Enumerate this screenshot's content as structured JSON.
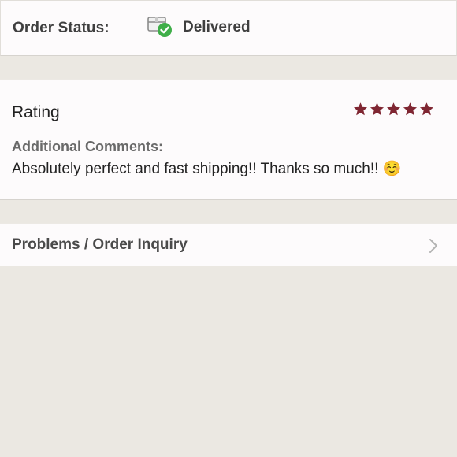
{
  "order_status": {
    "label": "Order Status:",
    "value": "Delivered",
    "icon": "package-delivered-icon",
    "status_color": "#3fae49"
  },
  "rating": {
    "title": "Rating",
    "stars": 5,
    "max_stars": 5,
    "star_color": "#7f2632",
    "comments_label": "Additional Comments:",
    "comments_text": "Absolutely perfect and fast shipping!! Thanks so much!! ☺️"
  },
  "inquiry": {
    "label": "Problems / Order Inquiry",
    "icon": "chevron-right-icon"
  }
}
